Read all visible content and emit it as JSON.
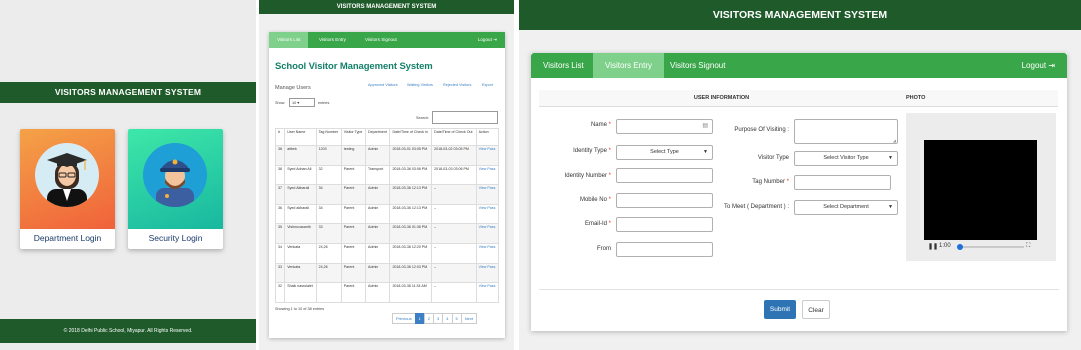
{
  "landing": {
    "header": "VISITORS MANAGEMENT SYSTEM",
    "cards": [
      {
        "label": "Department Login",
        "icon": "teacher-avatar-icon"
      },
      {
        "label": "Security Login",
        "icon": "security-guard-avatar-icon"
      }
    ],
    "footer": "© 2018 Delhi Public School, Miyapur. All Rights Reserved."
  },
  "list": {
    "header": "VISITORS MANAGEMENT SYSTEM",
    "tabs": [
      "Visitors List",
      "Visitors Entry",
      "Visitors Signout"
    ],
    "logout": "Logout ⇥",
    "title": "School Visitor Management System",
    "manage_users": "Manage Users",
    "links": [
      "Approved Visitors",
      "Waiting Visitors",
      "Rejected Visitors",
      "Export"
    ],
    "show_label": "Show",
    "show_value": "10",
    "entries_label": "entries",
    "search_label": "Search:",
    "columns": [
      "#",
      "User Name",
      "Tag Number",
      "Visitor Type",
      "Department",
      "Date/Time of Check In",
      "Date/Time of Check Out",
      "Action"
    ],
    "rows": [
      [
        "38",
        "aitbek",
        "1203",
        "testing",
        "Admin",
        "2018-03-01 03:05 PM",
        "2018-03-02 03:05 PM",
        "View Pass"
      ],
      [
        "38",
        "Syed Adnan Ali",
        "32",
        "Parent",
        "Transport",
        "2018-03-36 03:06 PM",
        "2018-03-03 03:06 PM",
        "View Pass"
      ],
      [
        "37",
        "Syed Akbarali",
        "34",
        "Parent",
        "Admin",
        "2018-03-36 12:13 PM",
        "–",
        "View Pass"
      ],
      [
        "36",
        "Syed akbarali",
        "34",
        "Parent",
        "Admin",
        "2018-03-36 12:13 PM",
        "–",
        "View Pass"
      ],
      [
        "35",
        "Vishnuvasanth",
        "33",
        "Parent",
        "Admin",
        "2018-03-36 01:36 PM",
        "–",
        "View Pass"
      ],
      [
        "34",
        "Venkata",
        "24,26",
        "Parent",
        "Admin",
        "2018-03-36 12:20 PM",
        "–",
        "View Pass"
      ],
      [
        "33",
        "Venkata",
        "24,26",
        "Parent",
        "Admin",
        "2018-03-36 12:03 PM",
        "–",
        "View Pass"
      ],
      [
        "32",
        "Shaik nasrulalet",
        "",
        "Parent",
        "Admin",
        "2018-03-36 11:34 AM",
        "–",
        "View Pass"
      ]
    ],
    "showing": "Showing 1 to 10 of 38 entries",
    "pager": [
      "Previous",
      "1",
      "2",
      "3",
      "4",
      "5",
      "Next"
    ]
  },
  "entry": {
    "header": "VISITORS MANAGEMENT SYSTEM",
    "tabs": [
      "Visitors List",
      "Visitors Entry",
      "Visitors Signout"
    ],
    "logout": "Logout ⇥",
    "section_user": "USER INFORMATION",
    "section_photo": "PHOTO",
    "left_fields": [
      {
        "label": "Name",
        "required": "*"
      },
      {
        "label": "Identity Type",
        "required": "*",
        "value": "Select Type"
      },
      {
        "label": "Identity Number",
        "required": "*"
      },
      {
        "label": "Mobile No",
        "required": "*"
      },
      {
        "label": "Email-Id",
        "required": "*"
      },
      {
        "label": "From",
        "required": ""
      }
    ],
    "right_fields": [
      {
        "label": "Purpose Of Visiting :"
      },
      {
        "label": "Visitor Type",
        "value": "Select Visitor Type"
      },
      {
        "label": "Tag Number",
        "required": "*"
      },
      {
        "label": "To Meet ( Department ) :",
        "value": "Select Department"
      }
    ],
    "video_time": "1:00",
    "submit": "Submit",
    "clear": "Clear",
    "accent": "#3aa64a",
    "header_color": "#1e5a2a"
  }
}
